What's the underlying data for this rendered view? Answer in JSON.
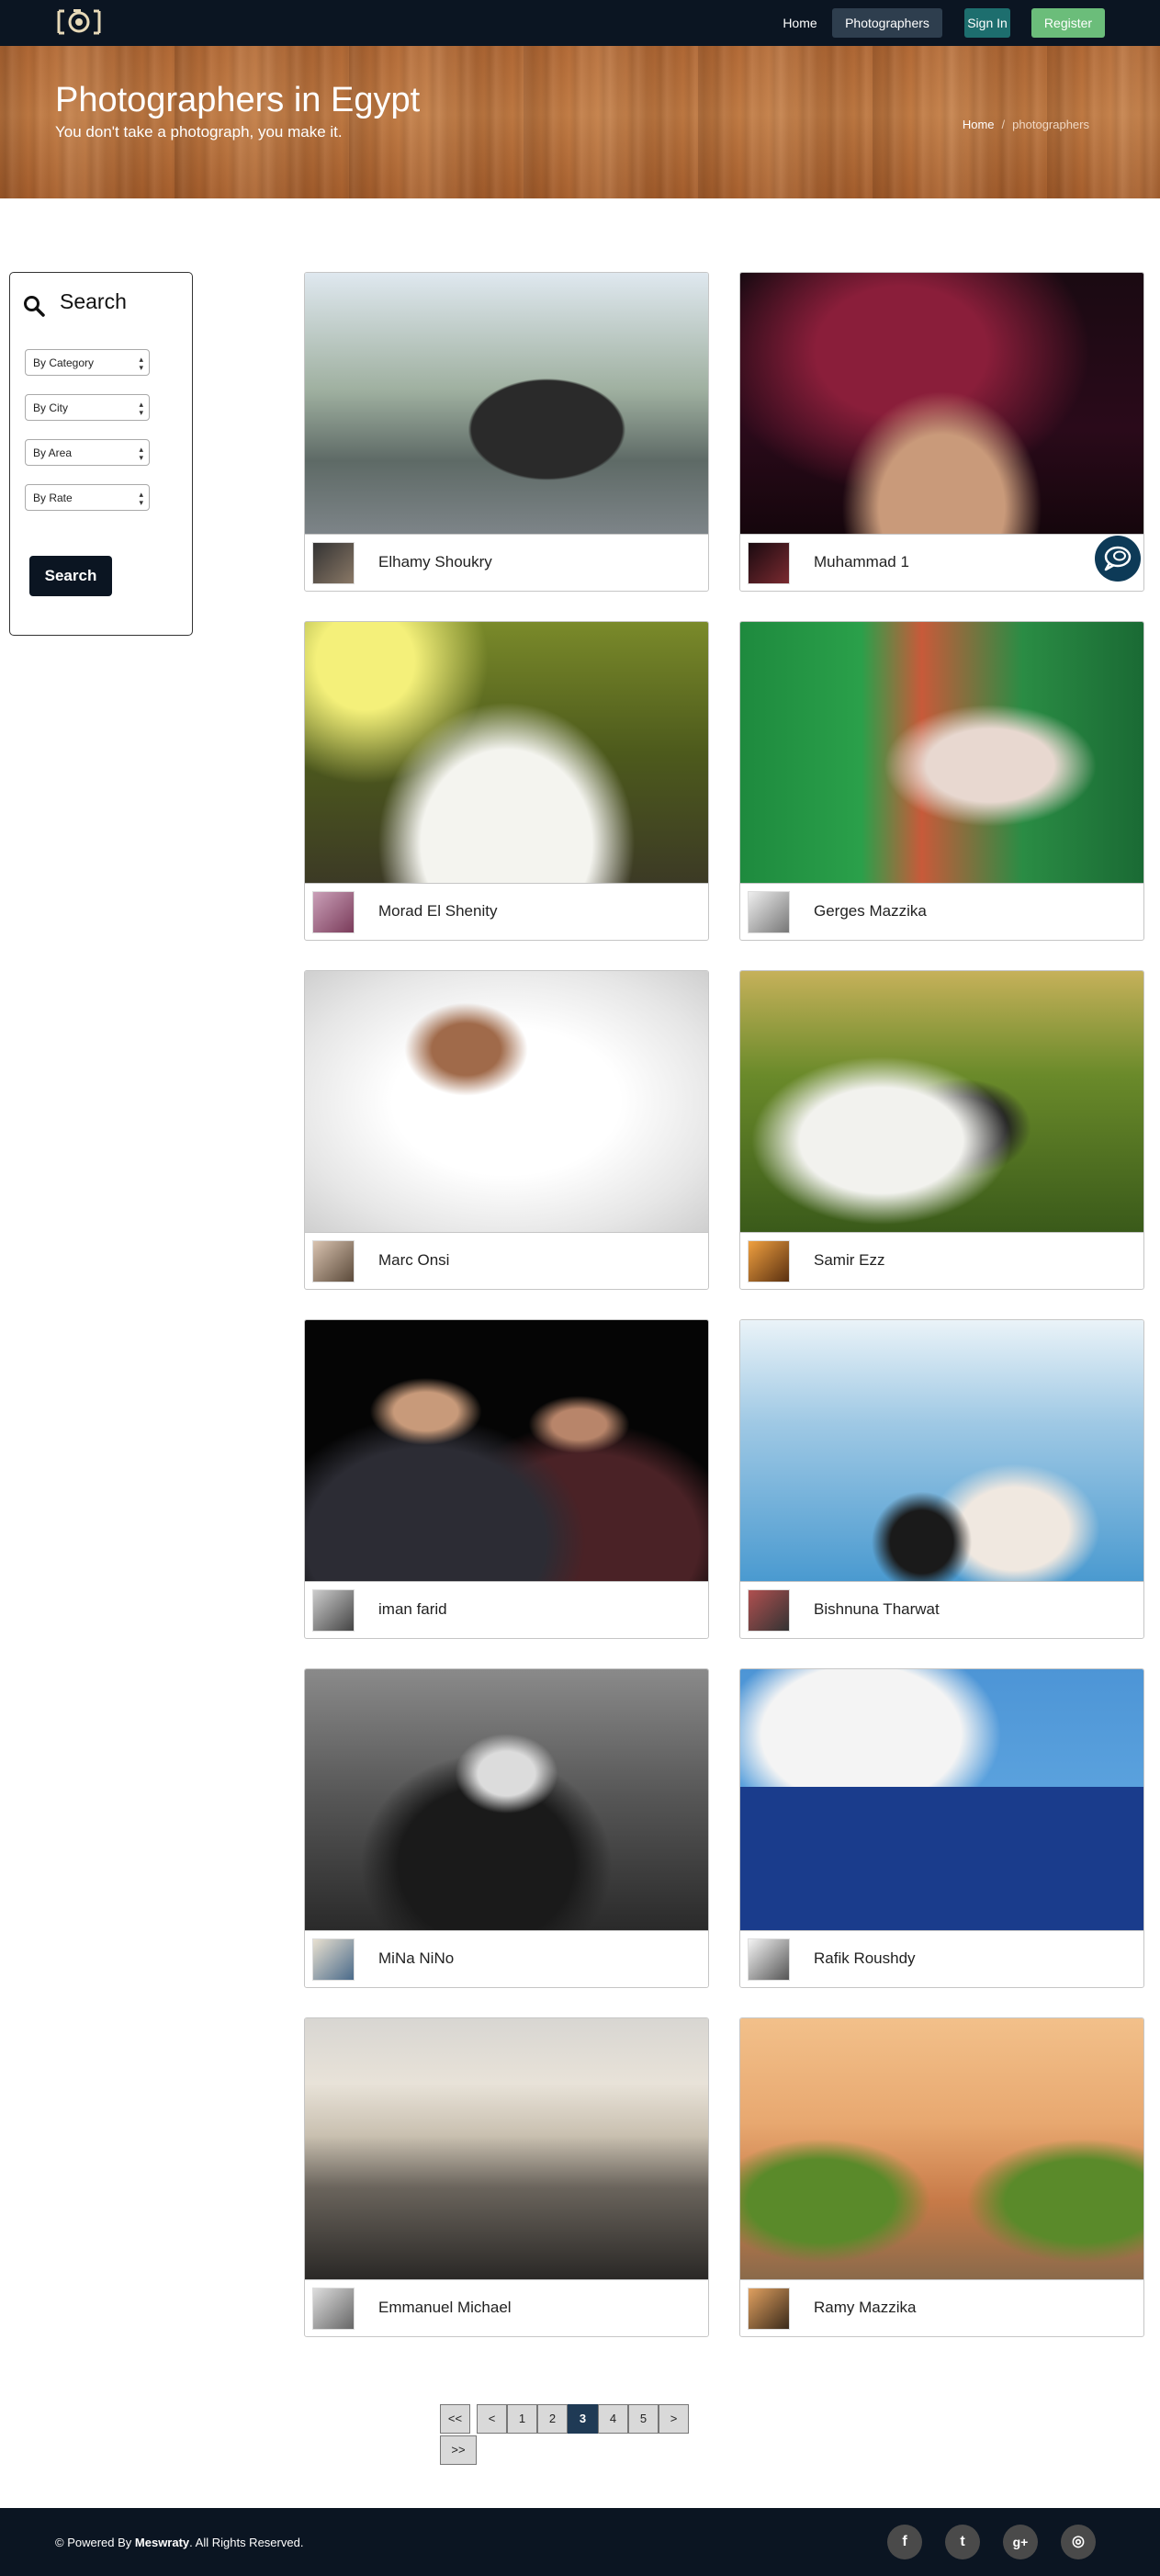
{
  "navbar": {
    "logo_icon": "camera-logo-icon",
    "items": [
      "Home",
      "Photographers",
      "Sign In",
      "Register"
    ],
    "active": "Photographers",
    "colors": {
      "bar": "#0b1522",
      "active": "#2e3e4e",
      "signin": "#1d6e6e",
      "register": "#6bbd7a"
    }
  },
  "hero": {
    "title": "Photographers in Egypt",
    "subtitle": "You don't take a photograph, you make it.",
    "breadcrumb": [
      "Home",
      "photographers"
    ]
  },
  "search": {
    "title": "Search",
    "icon": "search-icon",
    "filters": [
      "By Category",
      "By City",
      "By Area",
      "By Rate"
    ],
    "button": "Search"
  },
  "photographers": [
    {
      "name": "Elhamy Shoukry"
    },
    {
      "name": "Muhammad 1"
    },
    {
      "name": "Morad El Shenity"
    },
    {
      "name": "Gerges Mazzika"
    },
    {
      "name": "Marc Onsi"
    },
    {
      "name": "Samir Ezz"
    },
    {
      "name": "iman farid"
    },
    {
      "name": "Bishnuna Tharwat"
    },
    {
      "name": "MiNa NiNo"
    },
    {
      "name": "Rafik Roushdy"
    },
    {
      "name": "Emmanuel Michael"
    },
    {
      "name": "Ramy Mazzika"
    }
  ],
  "pagination": {
    "items": [
      "<<",
      "<",
      "1",
      "2",
      "3",
      "4",
      "5",
      ">",
      ">>"
    ],
    "current": "3"
  },
  "footer": {
    "prefix": "© Powered By ",
    "brand": "Meswraty",
    "suffix": ". All Rights Reserved.",
    "social": [
      {
        "icon": "facebook-icon",
        "glyph": "f"
      },
      {
        "icon": "twitter-icon",
        "glyph": "t"
      },
      {
        "icon": "google-plus-icon",
        "glyph": "g+"
      },
      {
        "icon": "instagram-icon",
        "glyph": "◎"
      }
    ]
  },
  "chat": {
    "icon": "chat-bubble-icon"
  }
}
